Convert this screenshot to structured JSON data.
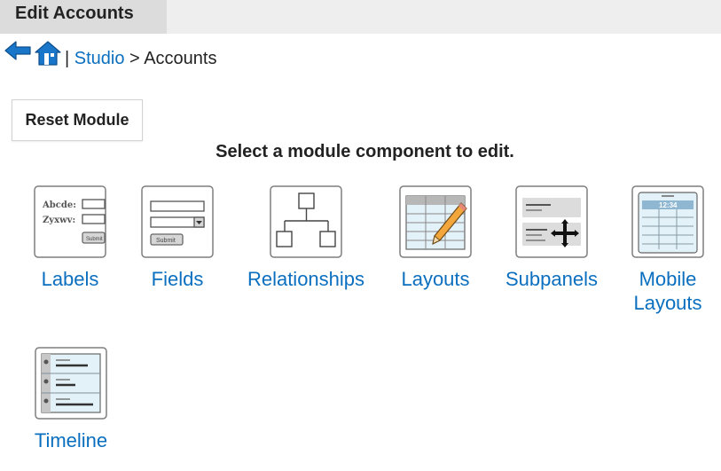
{
  "header": {
    "title": "Edit Accounts"
  },
  "breadcrumb": {
    "separator": "|",
    "link": "Studio",
    "arrow": ">",
    "current": "Accounts"
  },
  "reset_button": {
    "label": "Reset Module"
  },
  "instruction": "Select a module component to edit.",
  "components": [
    {
      "label": "Labels",
      "icon": "labels-icon"
    },
    {
      "label": "Fields",
      "icon": "fields-icon"
    },
    {
      "label": "Relationships",
      "icon": "relationships-icon"
    },
    {
      "label": "Layouts",
      "icon": "layouts-icon"
    },
    {
      "label": "Subpanels",
      "icon": "subpanels-icon"
    },
    {
      "label": "Mobile Layouts",
      "icon": "mobile-layouts-icon"
    },
    {
      "label": "Timeline",
      "icon": "timeline-icon"
    }
  ],
  "icon_texts": {
    "labels_field_1": "Abcde:",
    "labels_field_2": "Zyxwv:",
    "submit": "Submit",
    "mobile_time": "12:34"
  },
  "colors": {
    "link": "#0b6fbf",
    "icon_fill": "#cfe6f2",
    "title_bar": "#eeeeee",
    "title_tab": "#dcdcdc"
  }
}
